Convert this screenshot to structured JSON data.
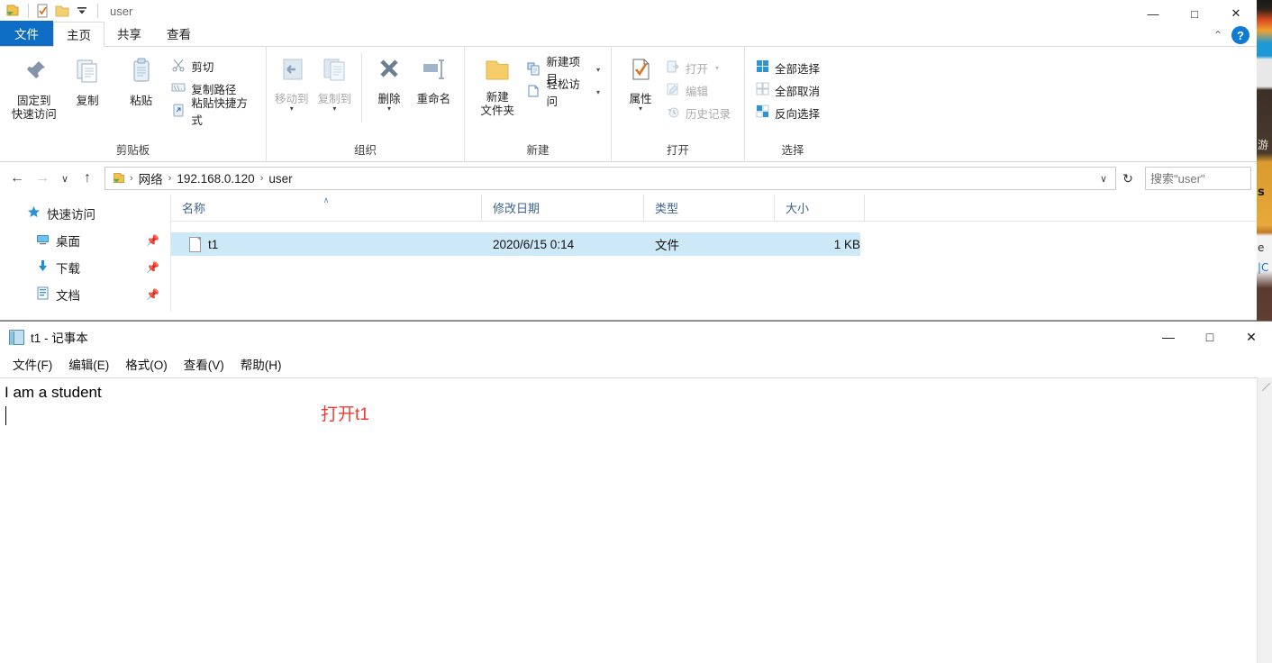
{
  "explorer": {
    "quick_access_toolbar": {
      "title": "user",
      "icons": [
        "folder-green-arrow-icon",
        "properties-check-icon",
        "folder-icon",
        "dropdown-caret-icon"
      ]
    },
    "window_controls": {
      "minimize": "—",
      "maximize": "□",
      "close": "✕"
    },
    "tabs": [
      {
        "label": "文件",
        "kind": "file"
      },
      {
        "label": "主页",
        "kind": "active"
      },
      {
        "label": "共享",
        "kind": "normal"
      },
      {
        "label": "查看",
        "kind": "normal"
      }
    ],
    "ribbon_right": {
      "collapse": "⌃",
      "help": "?"
    },
    "ribbon_groups": [
      {
        "label": "剪贴板",
        "big_buttons": [
          {
            "label": "固定到\n快速访问",
            "line1": "固定到",
            "line2": "快速访问",
            "icon": "pin-icon"
          },
          {
            "label": "复制",
            "line1": "复制",
            "line2": "",
            "icon": "copy-icon"
          },
          {
            "label": "粘贴",
            "line1": "粘贴",
            "line2": "",
            "icon": "paste-clipboard-icon"
          }
        ],
        "small_buttons": [
          {
            "label": "剪切",
            "icon": "scissors-icon",
            "dim": false
          },
          {
            "label": "复制路径",
            "icon": "copy-path-icon",
            "dim": false
          },
          {
            "label": "粘贴快捷方式",
            "icon": "paste-shortcut-icon",
            "dim": false
          }
        ]
      },
      {
        "label": "组织",
        "big_buttons": [
          {
            "line1": "移动到",
            "line2": "",
            "icon": "move-to-icon",
            "dim": true,
            "caret": true
          },
          {
            "line1": "复制到",
            "line2": "",
            "icon": "copy-to-icon",
            "dim": true,
            "caret": true
          },
          {
            "line1": "删除",
            "line2": "",
            "icon": "delete-x-icon",
            "dim": false,
            "caret": true
          },
          {
            "line1": "重命名",
            "line2": "",
            "icon": "rename-icon",
            "dim": false,
            "caret": false
          }
        ],
        "small_buttons": []
      },
      {
        "label": "新建",
        "big_buttons": [
          {
            "line1": "新建",
            "line2": "文件夹",
            "icon": "new-folder-icon"
          }
        ],
        "small_buttons": [
          {
            "label": "新建项目",
            "icon": "new-item-icon",
            "caret": true
          },
          {
            "label": "轻松访问",
            "icon": "easy-access-icon",
            "caret": true
          }
        ]
      },
      {
        "label": "打开",
        "big_buttons": [
          {
            "line1": "属性",
            "line2": "",
            "icon": "properties-icon",
            "caret": true
          }
        ],
        "small_buttons": [
          {
            "label": "打开",
            "icon": "open-icon",
            "dim": true,
            "caret": true
          },
          {
            "label": "编辑",
            "icon": "edit-icon",
            "dim": true
          },
          {
            "label": "历史记录",
            "icon": "history-icon",
            "dim": true
          }
        ]
      },
      {
        "label": "选择",
        "big_buttons": [],
        "small_buttons": [
          {
            "label": "全部选择",
            "icon": "select-all-icon"
          },
          {
            "label": "全部取消",
            "icon": "select-none-icon"
          },
          {
            "label": "反向选择",
            "icon": "invert-selection-icon"
          }
        ]
      }
    ],
    "address_bar": {
      "back": "←",
      "forward": "→",
      "recent": "∨",
      "up": "↑",
      "breadcrumbs": [
        "网络",
        "192.168.0.120",
        "user"
      ],
      "separator": "›",
      "dropdown": "∨",
      "refresh": "↻",
      "search_placeholder": "搜索\"user\"",
      "search_value": "",
      "search_icon": "magnifier-icon"
    },
    "nav_pane": [
      {
        "label": "快速访问",
        "icon": "star-icon",
        "pinned": false,
        "level": "root"
      },
      {
        "label": "桌面",
        "icon": "desktop-icon",
        "pinned": true,
        "level": "child"
      },
      {
        "label": "下载",
        "icon": "download-icon",
        "pinned": true,
        "level": "child"
      },
      {
        "label": "文档",
        "icon": "documents-icon",
        "pinned": true,
        "level": "child"
      }
    ],
    "columns": [
      {
        "label": "名称",
        "sorted": true,
        "sort_glyph": "∧"
      },
      {
        "label": "修改日期",
        "sorted": false
      },
      {
        "label": "类型",
        "sorted": false
      },
      {
        "label": "大小",
        "sorted": false
      }
    ],
    "files": [
      {
        "name": "t1",
        "date": "2020/6/15 0:14",
        "type": "文件",
        "size": "1 KB",
        "selected": true,
        "icon": "file-icon"
      }
    ]
  },
  "notepad": {
    "title": "t1 - 记事本",
    "icon": "notepad-icon",
    "window_controls": {
      "minimize": "—",
      "maximize": "□",
      "close": "✕"
    },
    "menus": [
      "文件(F)",
      "编辑(E)",
      "格式(O)",
      "查看(V)",
      "帮助(H)"
    ],
    "text_lines": [
      "I am a student",
      ""
    ],
    "caret_line": 2
  },
  "annotation": {
    "text": "打开t1",
    "color": "#ef3b33"
  },
  "desktop_background": {
    "fragments": [
      "游",
      "s",
      "e",
      "|С"
    ]
  }
}
